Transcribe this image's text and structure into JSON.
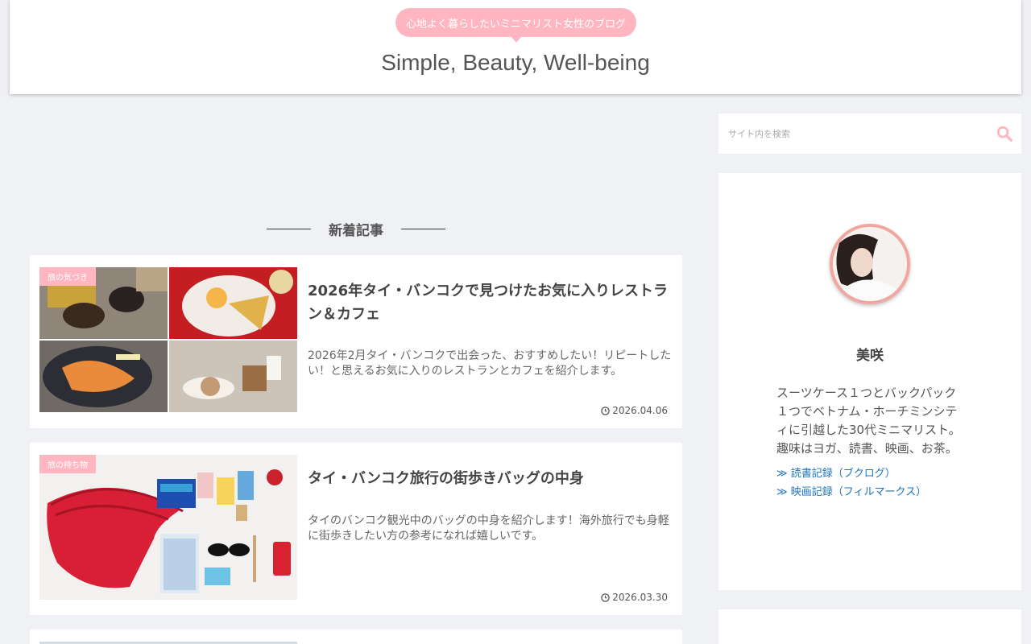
{
  "header": {
    "tagline": "心地よく暮らしたいミニマリスト女性のブログ",
    "site_title": "Simple, Beauty, Well-being"
  },
  "section": {
    "title": "新着記事"
  },
  "posts": [
    {
      "category": "旅の気づき",
      "title": "2026年タイ・バンコクで見つけたお気に入りレストラン＆カフェ",
      "snippet": "2026年2月タイ・バンコクで出会った、おすすめしたい！リピートしたい！と思えるお気に入りのレストランとカフェを紹介します。",
      "date": "2026.04.06"
    },
    {
      "category": "旅の持ち物",
      "title": "タイ・バンコク旅行の街歩きバッグの中身",
      "snippet": "タイのバンコク観光中のバッグの中身を紹介します！海外旅行でも身軽に街歩きしたい方の参考になれば嬉しいです。",
      "date": "2026.03.30"
    }
  ],
  "search": {
    "placeholder": "サイト内を検索"
  },
  "profile": {
    "name": "美咲",
    "bio": "スーツケース１つとバックパック１つでベトナム・ホーチミンシティに引越した30代ミニマリスト。趣味はヨガ、読書、映画、お茶。",
    "links": [
      "≫ 読書記録（ブクログ）",
      "≫ 映画記録（フィルマークス）"
    ]
  },
  "colors": {
    "accent": "#ffb6c1",
    "link": "#1e73be",
    "avatar_ring": "#f1a7a0"
  }
}
